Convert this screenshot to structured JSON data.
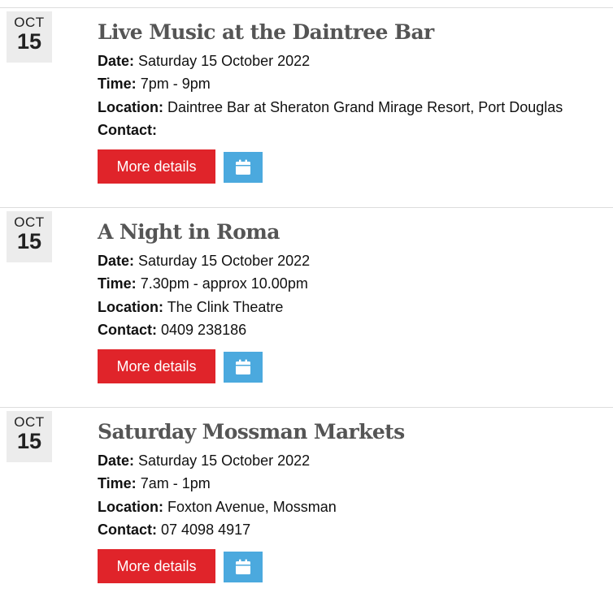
{
  "colors": {
    "primary_button": "#e0242a",
    "calendar_button": "#4ba9de",
    "title_text": "#555555",
    "badge_background": "#ececec"
  },
  "labels": {
    "date": "Date:",
    "time": "Time:",
    "location": "Location:",
    "contact": "Contact:",
    "more_details": "More details"
  },
  "events": [
    {
      "month": "OCT",
      "day": "15",
      "title": "Live Music at the Daintree Bar",
      "date": "Saturday 15 October 2022",
      "time": "7pm - 9pm",
      "location": "Daintree Bar at Sheraton Grand Mirage Resort, Port Douglas",
      "contact": "",
      "calendar_icon": "calendar-icon"
    },
    {
      "month": "OCT",
      "day": "15",
      "title": "A Night in Roma",
      "date": "Saturday 15 October 2022",
      "time": "7.30pm - approx 10.00pm",
      "location": "The Clink Theatre",
      "contact": "0409 238186",
      "calendar_icon": "calendar-icon"
    },
    {
      "month": "OCT",
      "day": "15",
      "title": "Saturday Mossman Markets",
      "date": "Saturday 15 October 2022",
      "time": "7am - 1pm",
      "location": "Foxton Avenue, Mossman",
      "contact": "07 4098 4917",
      "calendar_icon": "calendar-icon"
    }
  ]
}
